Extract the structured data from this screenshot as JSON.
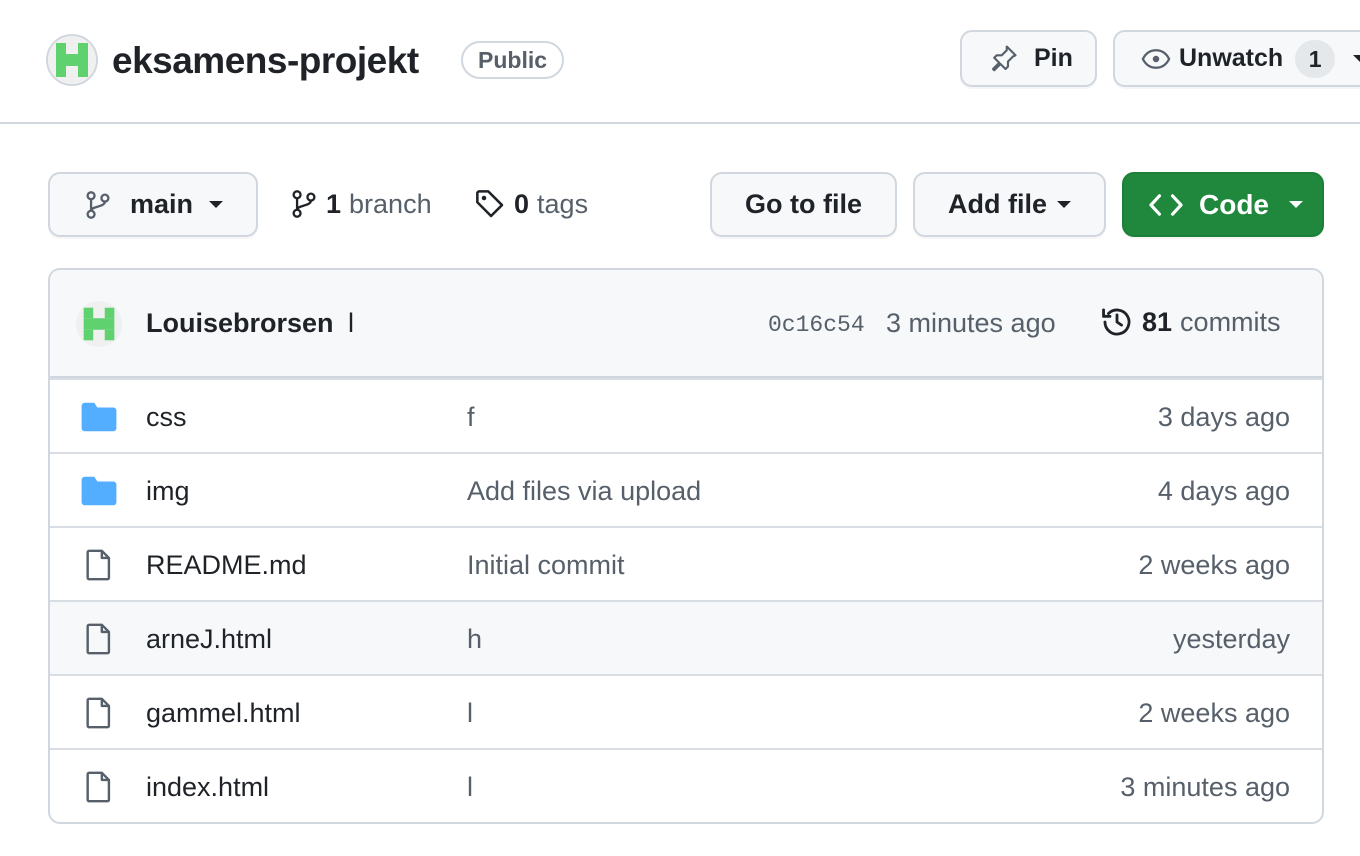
{
  "repo": {
    "name": "eksamens-projekt",
    "visibility": "Public",
    "pin_label": "Pin",
    "watch_label": "Unwatch",
    "watch_count": "1"
  },
  "toolbar": {
    "branch": "main",
    "branch_count": "1",
    "branch_word": "branch",
    "tag_count": "0",
    "tag_word": "tags",
    "go_to_file": "Go to file",
    "add_file": "Add file",
    "code": "Code"
  },
  "latest_commit": {
    "author": "Louisebrorsen",
    "message": "l",
    "sha": "0c16c54",
    "age": "3 minutes ago",
    "commit_count": "81",
    "commit_word": "commits"
  },
  "files": [
    {
      "type": "folder",
      "name": "css",
      "message": "f",
      "age": "3 days ago"
    },
    {
      "type": "folder",
      "name": "img",
      "message": "Add files via upload",
      "age": "4 days ago"
    },
    {
      "type": "file",
      "name": "README.md",
      "message": "Initial commit",
      "age": "2 weeks ago"
    },
    {
      "type": "file",
      "name": "arneJ.html",
      "message": "h",
      "age": "yesterday"
    },
    {
      "type": "file",
      "name": "gammel.html",
      "message": "l",
      "age": "2 weeks ago"
    },
    {
      "type": "file",
      "name": "index.html",
      "message": "l",
      "age": "3 minutes ago"
    }
  ],
  "colors": {
    "accent_green": "#1f883d",
    "folder_blue": "#54aeff",
    "avatar_green": "#5fd16f",
    "border": "#d0d7de",
    "muted_text": "#57606a"
  }
}
